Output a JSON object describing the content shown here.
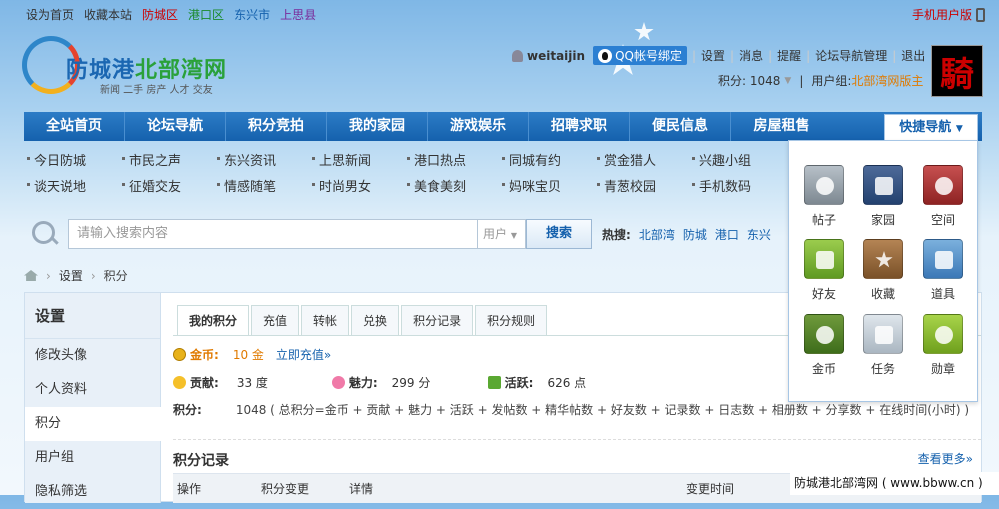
{
  "topbar": {
    "links": [
      "设为首页",
      "收藏本站",
      "防城区",
      "港口区",
      "东兴市",
      "上思县"
    ],
    "mobile": "手机用户版"
  },
  "logo": {
    "name_a": "防城港",
    "name_b": "北部湾网",
    "slogan": "新闻 二手 房产 人才 交友"
  },
  "user": {
    "name": "weitaijin",
    "qq_bind": "QQ帐号绑定",
    "links": [
      "设置",
      "消息",
      "提醒",
      "论坛导航管理",
      "退出"
    ],
    "points_label": "积分: 1048",
    "group_label": "用户组: ",
    "group": "北部湾网版主",
    "avatar_char": "騎"
  },
  "nav": {
    "items": [
      "全站首页",
      "论坛导航",
      "积分竞拍",
      "我的家园",
      "游戏娱乐",
      "招聘求职",
      "便民信息",
      "房屋租售"
    ],
    "quick": "快捷导航"
  },
  "subnav": [
    "今日防城",
    "市民之声",
    "东兴资讯",
    "上思新闻",
    "港口热点",
    "同城有约",
    "赏金猎人",
    "兴趣小组",
    "谈天说地",
    "征婚交友",
    "情感随笔",
    "时尚男女",
    "美食美刻",
    "妈咪宝贝",
    "青葱校园",
    "手机数码"
  ],
  "search": {
    "placeholder": "请输入搜索内容",
    "type": "用户",
    "button": "搜索",
    "hot_label": "热搜:",
    "hot": [
      "北部湾",
      "防城",
      "港口",
      "东兴"
    ]
  },
  "breadcrumb": [
    "设置",
    "积分"
  ],
  "side": {
    "title": "设置",
    "items": [
      "修改头像",
      "个人资料",
      "积分",
      "用户组",
      "隐私筛选"
    ]
  },
  "tabs": [
    "我的积分",
    "充值",
    "转帐",
    "兑换",
    "积分记录",
    "积分规则"
  ],
  "gold": {
    "label": "金币:",
    "value": "10 金",
    "link": "立即充值»"
  },
  "stats": [
    {
      "label": "贡献:",
      "value": "33 度"
    },
    {
      "label": "魅力:",
      "value": "299 分"
    },
    {
      "label": "活跃:",
      "value": "626 点"
    }
  ],
  "points": {
    "label": "积分:",
    "value": "1048 ( 总积分=金币 + 贡献 + 魅力 + 活跃 + 发帖数 + 精华帖数 + 好友数 + 记录数 + 日志数 + 相册数 + 分享数 + 在线时间(小时) )"
  },
  "records": {
    "title": "积分记录",
    "more": "查看更多»",
    "columns": [
      "操作",
      "积分变更",
      "详情",
      "变更时间"
    ]
  },
  "quicknav": [
    "帖子",
    "家园",
    "空间",
    "好友",
    "收藏",
    "道具",
    "金币",
    "任务",
    "勋章"
  ],
  "watermark": "防城港北部湾网 ( www.bbww.cn )",
  "colors": {
    "nav": "#1561ad",
    "accent_red": "#cc0000",
    "link_blue": "#1561ad",
    "gold": "#e07a00"
  }
}
